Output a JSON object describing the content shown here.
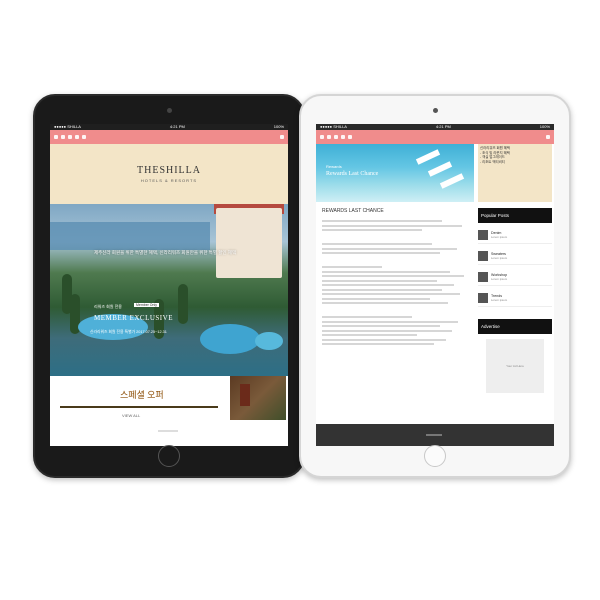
{
  "black_tablet": {
    "status": {
      "carrier": "●●●●● SHILLA",
      "time": "4:21 PM",
      "battery": "100%"
    },
    "brand": {
      "title": "THESHILLA",
      "subtitle": "HOTELS & RESORTS"
    },
    "hero": {
      "caption": "제주신라 회원을 위한 특별한 혜택, 신라리워즈 회원만을 위한 특별 할인 혜택",
      "tag": "리워즈 회원 전용",
      "badge": "Member Only",
      "title": "MEMBER EXCLUSIVE",
      "subtitle": "신라리워즈 회원 전용 특별가 2017.07.25~12.31"
    },
    "lower": {
      "title": "스페셜 오퍼",
      "subtitle": "VIEW ALL"
    }
  },
  "white_tablet": {
    "status": {
      "carrier": "●●●●● SHILLA",
      "time": "4:21 PM",
      "battery": "100%"
    },
    "hero": {
      "label": "Rewards",
      "title": "Rewards Last Chance"
    },
    "side_top": [
      "신라리워즈 회원 혜택",
      "- 조식 및 라운지 혜택",
      "- 객실 업그레이드",
      "- 리조트 액티비티"
    ],
    "main_title": "REWARDS LAST CHANCE",
    "sidebar": {
      "popular_title": "Popular Posts",
      "posts": [
        {
          "name": "Denim",
          "meta": "Lorem ipsum"
        },
        {
          "name": "Sweaters",
          "meta": "Lorem ipsum"
        },
        {
          "name": "Workshop",
          "meta": "Lorem ipsum"
        },
        {
          "name": "Trends",
          "meta": "Lorem ipsum"
        }
      ],
      "advertise_title": "Advertise",
      "ad_text": "Your Ad Here"
    }
  }
}
